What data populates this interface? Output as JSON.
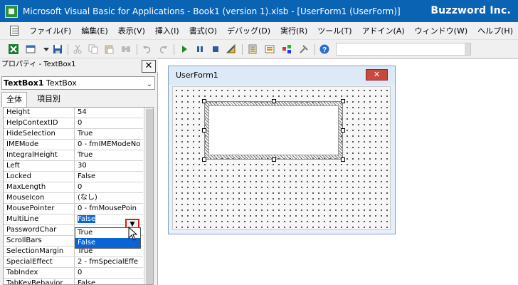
{
  "title": "Microsoft Visual Basic for Applications - Book1 (version 1).xlsb - [UserForm1 (UserForm)]",
  "brand": "Buzzword Inc.",
  "menu": [
    "ファイル(F)",
    "編集(E)",
    "表示(V)",
    "挿入(I)",
    "書式(O)",
    "デバッグ(D)",
    "実行(R)",
    "ツール(T)",
    "アドイン(A)",
    "ウィンドウ(W)",
    "ヘルプ(H)"
  ],
  "properties": {
    "pane_title": "プロパティ - TextBox1",
    "close_label": "✕",
    "object_name": "TextBox1",
    "object_type": "TextBox",
    "tabs": [
      "全体",
      "項目別"
    ],
    "rows": [
      {
        "name": "Height",
        "value": "54"
      },
      {
        "name": "HelpContextID",
        "value": "0"
      },
      {
        "name": "HideSelection",
        "value": "True"
      },
      {
        "name": "IMEMode",
        "value": "0 - fmIMEModeNo"
      },
      {
        "name": "IntegralHeight",
        "value": "True"
      },
      {
        "name": "Left",
        "value": "30"
      },
      {
        "name": "Locked",
        "value": "False"
      },
      {
        "name": "MaxLength",
        "value": "0"
      },
      {
        "name": "MouseIcon",
        "value": "(なし)"
      },
      {
        "name": "MousePointer",
        "value": "0 - fmMousePoin"
      },
      {
        "name": "MultiLine",
        "value": "False"
      },
      {
        "name": "PasswordChar",
        "value": ""
      },
      {
        "name": "ScrollBars",
        "value": ""
      },
      {
        "name": "SelectionMargin",
        "value": "True"
      },
      {
        "name": "SpecialEffect",
        "value": "2 - fmSpecialEffe"
      },
      {
        "name": "TabIndex",
        "value": "0"
      },
      {
        "name": "TabKeyBehavior",
        "value": "False"
      }
    ],
    "dropdown_options": [
      "True",
      "False"
    ],
    "dropdown_arrow": "▼"
  },
  "userform": {
    "title": "UserForm1",
    "close_label": "✕"
  },
  "colors": {
    "titlebar": "#0b63b4",
    "selection": "#0a64d6",
    "highlight_box": "#d41f1f"
  },
  "toolbar_icons": [
    "excel-icon",
    "insert-userform-icon",
    "save-icon",
    "cut-icon",
    "copy-icon",
    "paste-icon",
    "find-icon",
    "undo-icon",
    "redo-icon",
    "run-icon",
    "break-icon",
    "reset-icon",
    "design-mode-icon",
    "project-explorer-icon",
    "properties-icon",
    "object-browser-icon",
    "toolbox-icon",
    "help-icon"
  ]
}
